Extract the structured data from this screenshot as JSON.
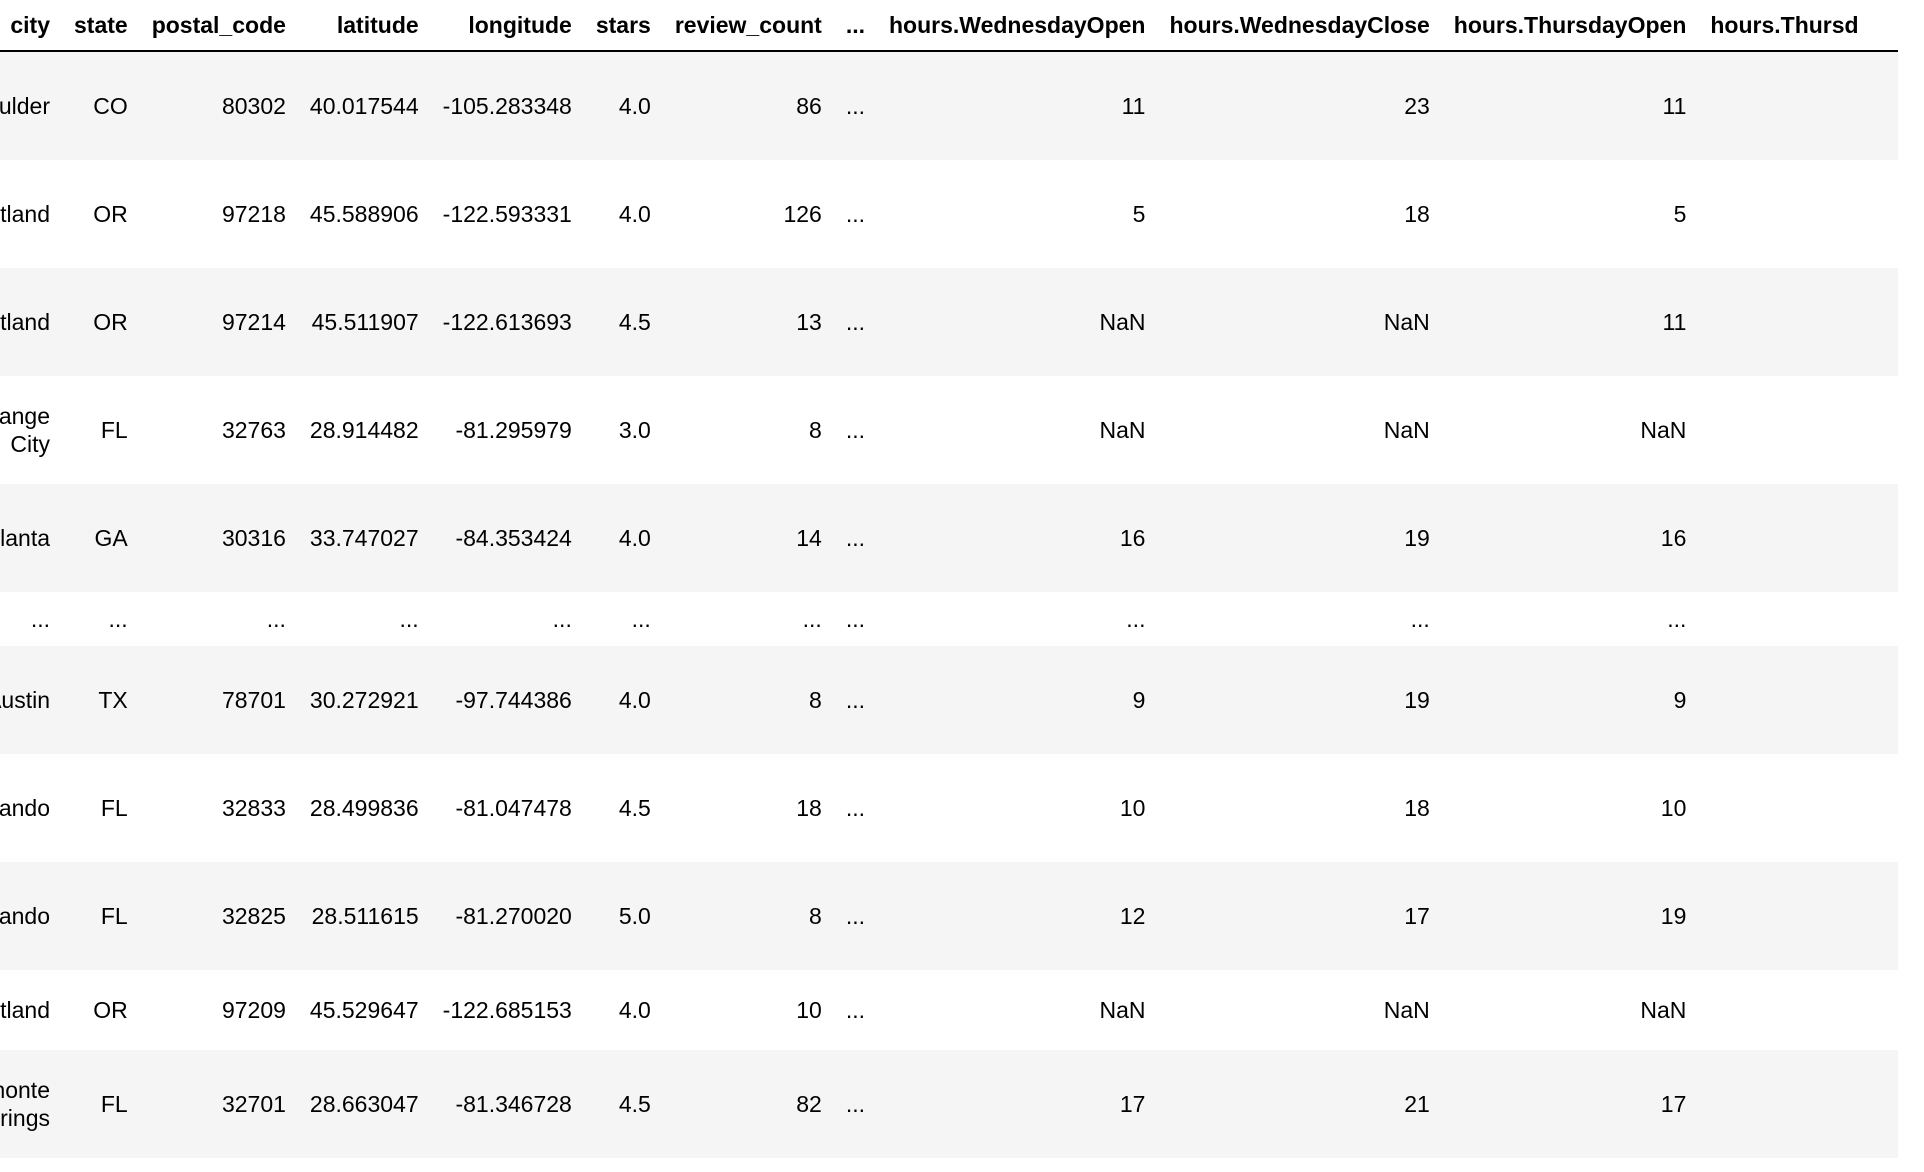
{
  "table": {
    "columns": [
      "city",
      "state",
      "postal_code",
      "latitude",
      "longitude",
      "stars",
      "review_count",
      "...",
      "hours.WednesdayOpen",
      "hours.WednesdayClose",
      "hours.ThursdayOpen",
      "hours.Thursd"
    ],
    "rows": [
      [
        "oulder",
        "CO",
        "80302",
        "40.017544",
        "-105.283348",
        "4.0",
        "86",
        "...",
        "11",
        "23",
        "11",
        ""
      ],
      [
        "rtland",
        "OR",
        "97218",
        "45.588906",
        "-122.593331",
        "4.0",
        "126",
        "...",
        "5",
        "18",
        "5",
        ""
      ],
      [
        "rtland",
        "OR",
        "97214",
        "45.511907",
        "-122.613693",
        "4.5",
        "13",
        "...",
        "NaN",
        "NaN",
        "11",
        ""
      ],
      [
        "range City",
        "FL",
        "32763",
        "28.914482",
        "-81.295979",
        "3.0",
        "8",
        "...",
        "NaN",
        "NaN",
        "NaN",
        ""
      ],
      [
        "tlanta",
        "GA",
        "30316",
        "33.747027",
        "-84.353424",
        "4.0",
        "14",
        "...",
        "16",
        "19",
        "16",
        ""
      ],
      [
        "...",
        "...",
        "...",
        "...",
        "...",
        "...",
        "...",
        "...",
        "...",
        "...",
        "...",
        ""
      ],
      [
        "Austin",
        "TX",
        "78701",
        "30.272921",
        "-97.744386",
        "4.0",
        "8",
        "...",
        "9",
        "19",
        "9",
        ""
      ],
      [
        "rlando",
        "FL",
        "32833",
        "28.499836",
        "-81.047478",
        "4.5",
        "18",
        "...",
        "10",
        "18",
        "10",
        ""
      ],
      [
        "rlando",
        "FL",
        "32825",
        "28.511615",
        "-81.270020",
        "5.0",
        "8",
        "...",
        "12",
        "17",
        "19",
        ""
      ],
      [
        "rtland",
        "OR",
        "97209",
        "45.529647",
        "-122.685153",
        "4.0",
        "10",
        "...",
        "NaN",
        "NaN",
        "NaN",
        ""
      ],
      [
        "monte prings",
        "FL",
        "32701",
        "28.663047",
        "-81.346728",
        "4.5",
        "82",
        "...",
        "17",
        "21",
        "17",
        ""
      ]
    ]
  }
}
